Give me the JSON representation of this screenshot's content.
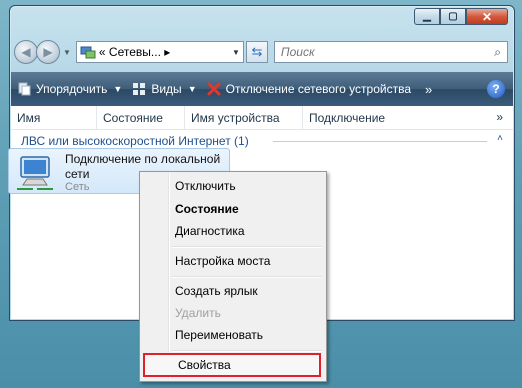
{
  "window": {
    "minimize_icon": "minimize-icon",
    "maximize_icon": "maximize-icon",
    "close_icon": "close-icon"
  },
  "navigation": {
    "back_icon": "back-arrow-icon",
    "forward_icon": "forward-arrow-icon",
    "address_text": "« Сетевы... ▸",
    "refresh_icon": "refresh-icon",
    "search_placeholder": "Поиск"
  },
  "toolbar": {
    "organize_label": "Упорядочить",
    "views_label": "Виды",
    "disconnect_label": "Отключение сетевого устройства",
    "more_label": "»",
    "help_label": "?"
  },
  "columns": {
    "name": "Имя",
    "status": "Состояние",
    "device_name": "Имя устройства",
    "connection": "Подключение",
    "more": "»"
  },
  "group": {
    "title": "ЛВС или высокоскоростной Интернет (1)",
    "collapse": "˄"
  },
  "connection": {
    "name": "Подключение по локальной сети",
    "status": "Сеть"
  },
  "context_menu": {
    "items": [
      {
        "label": "Отключить"
      },
      {
        "label": "Состояние"
      },
      {
        "label": "Диагностика"
      },
      {
        "label": "Настройка моста"
      },
      {
        "label": "Создать ярлык"
      },
      {
        "label": "Удалить"
      },
      {
        "label": "Переименовать"
      },
      {
        "label": "Свойства"
      }
    ]
  },
  "colors": {
    "toolbar": "#3e5d79",
    "highlight_border": "#e0202a",
    "group_text": "#1e4f8f"
  }
}
